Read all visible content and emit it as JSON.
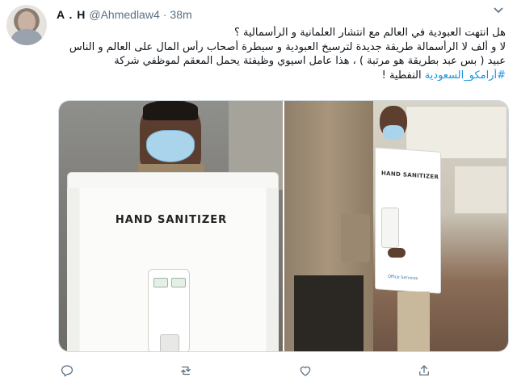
{
  "tweet": {
    "display_name": "A . H",
    "handle": "@Ahmedlaw4",
    "separator": "·",
    "time": "38m",
    "text_lines": [
      "هل انتهت العبودية في العالم مع انتشار العلمانية و الرأسمالية ؟",
      "لا و ألف لا الرأسمالة طريقة جديدة لترسيخ العبودية و سيطرة أصحاب رأس المال على العالم و الناس",
      "عبيد ( بس عبد بطريقة هو مرتبة ) ، هذا عامل اسيوي وظيفتة يحمل المعقم لموظفي شركة"
    ],
    "hashtag": "#أرامكو_السعودية",
    "tail_text": " النفطية !"
  },
  "media": {
    "left_photo_sign_text": "HAND SANITIZER",
    "right_photo_sign_text": "HAND SANITIZER",
    "right_photo_badge_text": "Office Services"
  },
  "actions": {
    "reply_icon": "reply-icon",
    "retweet_icon": "retweet-icon",
    "like_icon": "like-icon",
    "share_icon": "share-icon"
  },
  "colors": {
    "hashtag": "#1b95e0",
    "secondary_text": "#5b7083",
    "text": "#0f1419"
  }
}
